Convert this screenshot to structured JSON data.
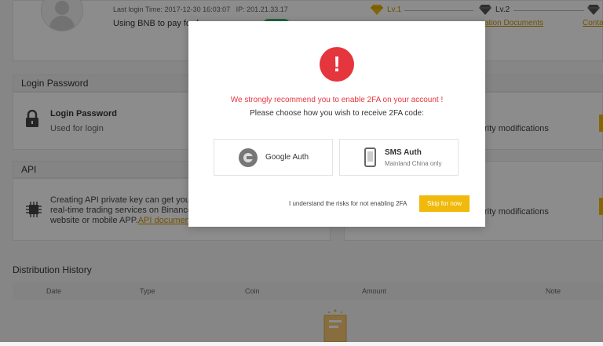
{
  "account": {
    "last_login_label": "Last login Time:",
    "last_login_time": "2017-12-30 16:03:07",
    "ip_label": "IP:",
    "ip": "201.21.33.17",
    "bnb_text": "Using BNB to pay for fe"
  },
  "levels": {
    "lv1": "Lv.1",
    "lv2": "Lv.2",
    "lv2_link": "cation Documents",
    "lv3_link": "Conta"
  },
  "login_password": {
    "section_title": "Login Password",
    "title": "Login Password",
    "subtitle": "Used for login"
  },
  "api": {
    "section_title": "API",
    "line1": "Creating API private key can get you acc",
    "line2": "real-time trading services on Binance via",
    "line3_prefix": "website or mobile APP.",
    "doc_link": "API documentation"
  },
  "right_panels": {
    "text1": "rity modifications",
    "text2": "rity modifications"
  },
  "distribution": {
    "title": "Distribution History",
    "columns": [
      "Date",
      "Type",
      "Coin",
      "Amount",
      "Note"
    ]
  },
  "modal": {
    "warning": "We strongly recommend you to enable 2FA on your account !",
    "instruction": "Please choose how you wish to receive 2FA code:",
    "google_label": "Google Auth",
    "sms_label": "SMS Auth",
    "sms_sub": "Mainland China only",
    "risk_text": "I understand the risks for not enabling 2FA",
    "skip_button": "Skip for now"
  },
  "colors": {
    "accent": "#f0b90b",
    "danger": "#e5353d",
    "link": "#c99400"
  }
}
